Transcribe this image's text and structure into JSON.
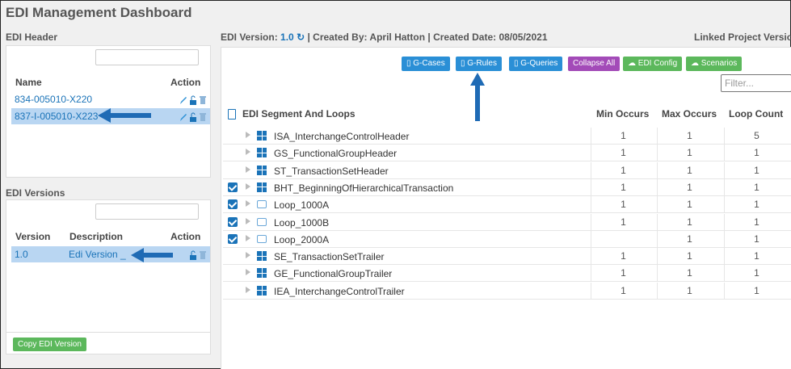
{
  "app": {
    "title": "EDI Management Dashboard"
  },
  "edi_header": {
    "section_title": "EDI Header",
    "col_name": "Name",
    "col_action": "Action",
    "items": [
      {
        "name": "834-005010-X220",
        "selected": false
      },
      {
        "name": "837-I-005010-X223",
        "selected": true
      }
    ]
  },
  "edi_versions": {
    "section_title": "EDI Versions",
    "col_version": "Version",
    "col_description": "Description",
    "col_action": "Action",
    "items": [
      {
        "version": "1.0",
        "description": "Edi Version _",
        "selected": true
      }
    ],
    "copy_button": "Copy EDI Version"
  },
  "version_bar": {
    "label": "EDI Version:",
    "version": "1.0",
    "rest": "| Created By: April Hatton | Created Date: 08/05/2021",
    "linked": "Linked Project Versio"
  },
  "toolbar": {
    "g_cases": "G-Cases",
    "g_rules": "G-Rules",
    "g_queries": "G-Queries",
    "collapse_all": "Collapse All",
    "edi_config": "EDI Config",
    "scenarios": "Scenarios",
    "filter_placeholder": "Filter..."
  },
  "grid": {
    "col_segment": "EDI Segment And Loops",
    "col_min": "Min Occurs",
    "col_max": "Max Occurs",
    "col_loop": "Loop Count",
    "rows": [
      {
        "name": "ISA_InterchangeControlHeader",
        "checked": false,
        "icon": "segment-icon",
        "min": "1",
        "max": "1",
        "loop": "5"
      },
      {
        "name": "GS_FunctionalGroupHeader",
        "checked": false,
        "icon": "segment-icon",
        "min": "1",
        "max": "1",
        "loop": "1"
      },
      {
        "name": "ST_TransactionSetHeader",
        "checked": false,
        "icon": "segment-icon",
        "min": "1",
        "max": "1",
        "loop": "1"
      },
      {
        "name": "BHT_BeginningOfHierarchicalTransaction",
        "checked": true,
        "icon": "segment-icon",
        "min": "1",
        "max": "1",
        "loop": "1"
      },
      {
        "name": "Loop_1000A",
        "checked": true,
        "icon": "loop-icon",
        "min": "1",
        "max": "1",
        "loop": "1"
      },
      {
        "name": "Loop_1000B",
        "checked": true,
        "icon": "loop-icon",
        "min": "1",
        "max": "1",
        "loop": "1"
      },
      {
        "name": "Loop_2000A",
        "checked": true,
        "icon": "loop-icon",
        "min": "",
        "max": "1",
        "loop": "1"
      },
      {
        "name": "SE_TransactionSetTrailer",
        "checked": false,
        "icon": "segment-icon",
        "min": "1",
        "max": "1",
        "loop": "1"
      },
      {
        "name": "GE_FunctionalGroupTrailer",
        "checked": false,
        "icon": "segment-icon",
        "min": "1",
        "max": "1",
        "loop": "1"
      },
      {
        "name": "IEA_InterchangeControlTrailer",
        "checked": false,
        "icon": "segment-icon",
        "min": "1",
        "max": "1",
        "loop": "1"
      }
    ]
  },
  "colors": {
    "accent": "#1a73b8",
    "selected_row": "#b9d6f2",
    "green": "#5cb85c",
    "purple": "#a34bb8"
  }
}
